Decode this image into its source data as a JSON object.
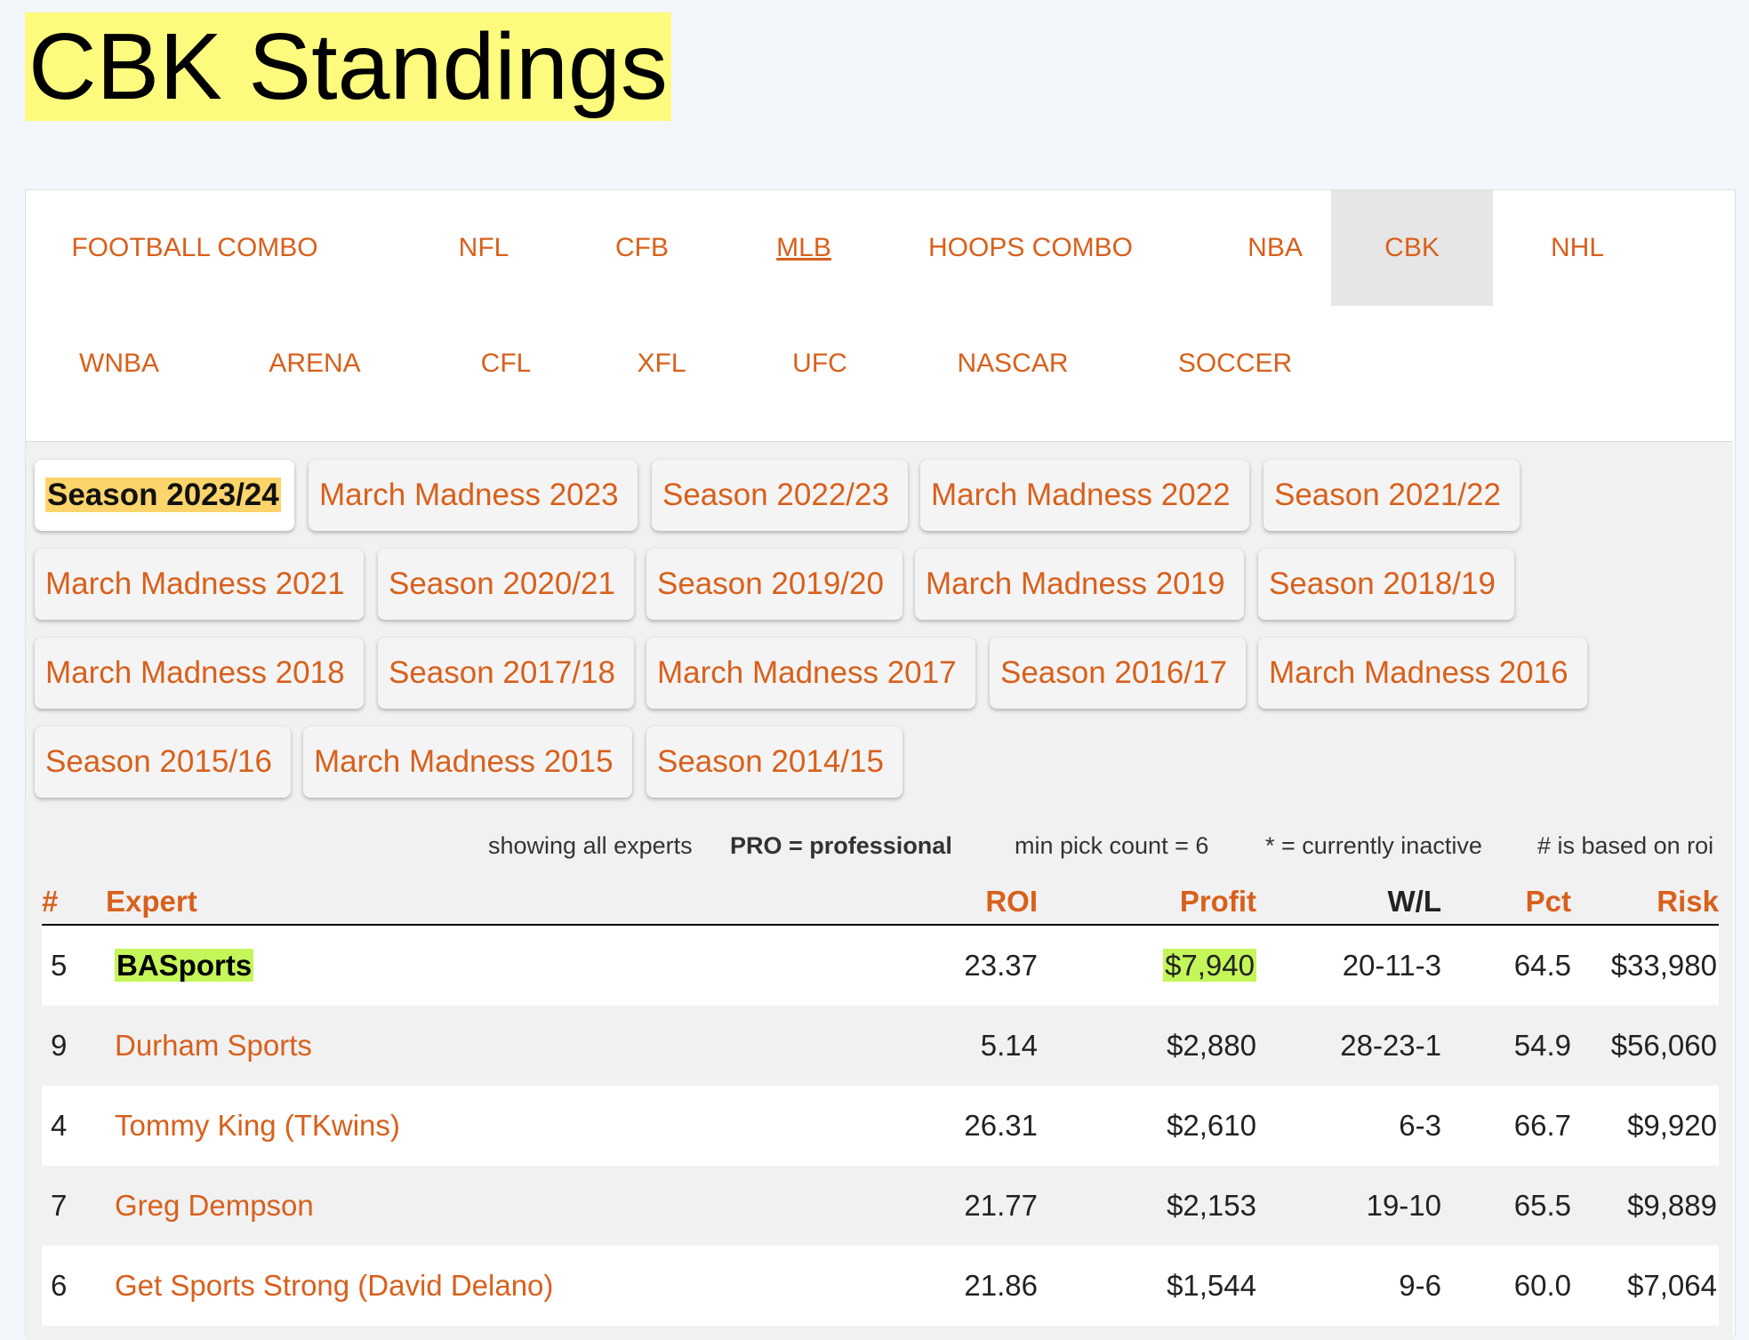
{
  "page": {
    "title": "CBK Standings"
  },
  "sports_nav": {
    "items": [
      {
        "label": "FOOTBALL COMBO"
      },
      {
        "label": "NFL"
      },
      {
        "label": "CFB"
      },
      {
        "label": "MLB"
      },
      {
        "label": "HOOPS COMBO"
      },
      {
        "label": "NBA"
      },
      {
        "label": "CBK",
        "active": true
      },
      {
        "label": "NHL"
      },
      {
        "label": "WNBA"
      },
      {
        "label": "ARENA"
      },
      {
        "label": "CFL"
      },
      {
        "label": "XFL"
      },
      {
        "label": "UFC"
      },
      {
        "label": "NASCAR"
      },
      {
        "label": "SOCCER"
      }
    ]
  },
  "season_tabs": {
    "items": [
      {
        "label": "Season 2023/24",
        "active": true
      },
      {
        "label": "March Madness 2023"
      },
      {
        "label": "Season 2022/23"
      },
      {
        "label": "March Madness 2022"
      },
      {
        "label": "Season 2021/22"
      },
      {
        "label": "March Madness 2021"
      },
      {
        "label": "Season 2020/21"
      },
      {
        "label": "Season 2019/20"
      },
      {
        "label": "March Madness 2019"
      },
      {
        "label": "Season 2018/19"
      },
      {
        "label": "March Madness 2018"
      },
      {
        "label": "Season 2017/18"
      },
      {
        "label": "March Madness 2017"
      },
      {
        "label": "Season 2016/17"
      },
      {
        "label": "March Madness 2016"
      },
      {
        "label": "Season 2015/16"
      },
      {
        "label": "March Madness 2015"
      },
      {
        "label": "Season 2014/15"
      }
    ]
  },
  "legend": {
    "showing": "showing all experts",
    "pro": "PRO = professional",
    "min_pick": "min pick count = 6",
    "inactive": "* = currently inactive",
    "rank_basis": "# is based on roi"
  },
  "table": {
    "headers": {
      "rank": "#",
      "expert": "Expert",
      "roi": "ROI",
      "profit": "Profit",
      "wl": "W/L",
      "pct": "Pct",
      "risk": "Risk"
    },
    "rows": [
      {
        "rank": "5",
        "expert": "BASports",
        "roi": "23.37",
        "profit": "$7,940",
        "wl": "20-11-3",
        "pct": "64.5",
        "risk": "$33,980",
        "featured": true
      },
      {
        "rank": "9",
        "expert": "Durham Sports",
        "roi": "5.14",
        "profit": "$2,880",
        "wl": "28-23-1",
        "pct": "54.9",
        "risk": "$56,060"
      },
      {
        "rank": "4",
        "expert": "Tommy King (TKwins)",
        "roi": "26.31",
        "profit": "$2,610",
        "wl": "6-3",
        "pct": "66.7",
        "risk": "$9,920"
      },
      {
        "rank": "7",
        "expert": "Greg Dempson",
        "roi": "21.77",
        "profit": "$2,153",
        "wl": "19-10",
        "pct": "65.5",
        "risk": "$9,889"
      },
      {
        "rank": "6",
        "expert": "Get Sports Strong (David Delano)",
        "roi": "21.86",
        "profit": "$1,544",
        "wl": "9-6",
        "pct": "60.0",
        "risk": "$7,064"
      }
    ]
  },
  "colors": {
    "page_bg": "#f3f6fb",
    "title_highlight": "#fdfb7e",
    "link_orange": "#d8601c",
    "active_tab_bg": "#e6e6e6",
    "active_season_highlight": "#fbd46b",
    "featured_highlight": "#c4f65a"
  }
}
